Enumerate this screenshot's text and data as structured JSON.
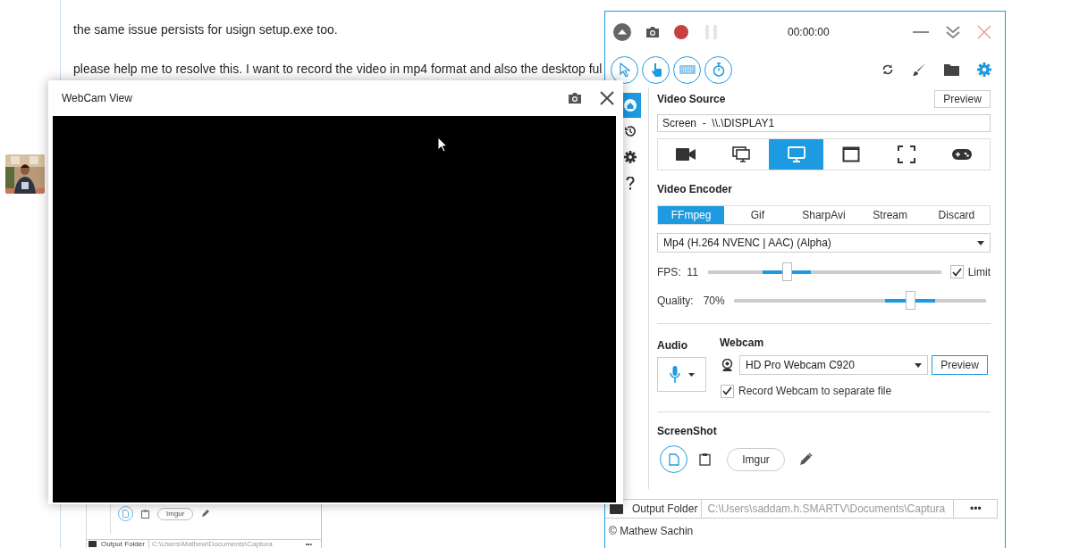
{
  "page": {
    "paragraphs": [
      "the same issue persists for usign setup.exe too.",
      "please help me to resolve this. I want to record the video in mp4 format and also the desktop ful"
    ]
  },
  "embedded_screenshot": {
    "imgur": "Imgur",
    "output_label": "Output Folder",
    "path": "C:\\Users\\Mathew\\Documents\\Captura",
    "more": "•••"
  },
  "webcam_window": {
    "title": "WebCam View"
  },
  "captura": {
    "timer": "00:00:00",
    "sidebar": [
      {
        "kind": "home",
        "selected": true
      },
      {
        "kind": "history",
        "selected": false
      },
      {
        "kind": "settings",
        "selected": false
      },
      {
        "kind": "help",
        "selected": false
      }
    ],
    "video_source": {
      "title": "Video Source",
      "preview": "Preview",
      "value": "Screen  -  \\\\.\\DISPLAY1",
      "sources": [
        {
          "kind": "camera",
          "selected": false
        },
        {
          "kind": "screens",
          "selected": false
        },
        {
          "kind": "screen",
          "selected": true
        },
        {
          "kind": "window",
          "selected": false
        },
        {
          "kind": "region",
          "selected": false
        },
        {
          "kind": "game",
          "selected": false
        }
      ]
    },
    "video_encoder": {
      "title": "Video Encoder",
      "tabs": [
        {
          "label": "FFmpeg",
          "selected": true
        },
        {
          "label": "Gif",
          "selected": false
        },
        {
          "label": "SharpAvi",
          "selected": false
        },
        {
          "label": "Stream",
          "selected": false
        },
        {
          "label": "Discard",
          "selected": false
        }
      ],
      "format": "Mp4 (H.264 NVENC | AAC) (Alpha)",
      "fps": {
        "label": "FPS:",
        "value": "11",
        "level": 0.34,
        "limit": {
          "label": "Limit",
          "checked": true
        }
      },
      "quality": {
        "label": "Quality:",
        "value": "70%",
        "level": 0.7
      }
    },
    "audio": {
      "title": "Audio"
    },
    "webcam": {
      "title": "Webcam",
      "device": "HD Pro Webcam C920",
      "preview": "Preview",
      "separate_file": {
        "label": "Record Webcam to separate file",
        "checked": true
      }
    },
    "screenshot": {
      "title": "ScreenShot",
      "imgur": "Imgur"
    },
    "output": {
      "label": "Output Folder",
      "path": "C:\\Users\\saddam.h.SMARTV\\Documents\\Captura",
      "more": "•••"
    },
    "footer": "© Mathew Sachin"
  }
}
